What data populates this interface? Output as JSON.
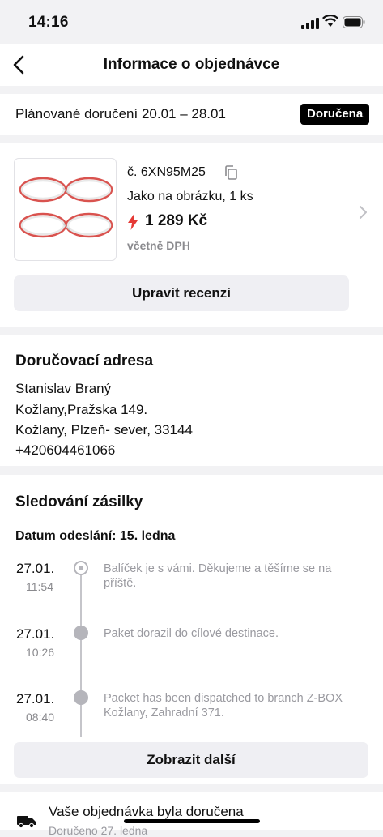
{
  "status_bar": {
    "time": "14:16"
  },
  "header": {
    "title": "Informace o objednávce"
  },
  "delivery": {
    "planned": "Plánované doručení 20.01 – 28.01",
    "status_badge": "Doručena"
  },
  "product": {
    "order_number": "č. 6XN95M25",
    "variant": "Jako na obrázku, 1 ks",
    "price": "1 289 Kč",
    "vat_note": "včetně DPH",
    "review_button": "Upravit recenzi",
    "accent_color": "#e53935"
  },
  "address": {
    "title": "Doručovací adresa",
    "lines": [
      "Stanislav Braný",
      "Kožlany,Pražska 149.",
      "Kožlany, Plzeň- sever, 33144",
      "+420604461066"
    ]
  },
  "tracking": {
    "title": "Sledování zásilky",
    "ship_date": "Datum odeslání: 15. ledna",
    "events": [
      {
        "date": "27.01.",
        "time": "11:54",
        "text": "Balíček je s vámi. Děkujeme a těšíme se na příště."
      },
      {
        "date": "27.01.",
        "time": "10:26",
        "text": "Paket dorazil do cílové destinace."
      },
      {
        "date": "27.01.",
        "time": "08:40",
        "text": "Packet has been dispatched to branch Z-BOX Kožlany, Zahradní 371."
      }
    ],
    "more_button": "Zobrazit další"
  },
  "notice": {
    "text": "Vaše objednávka byla doručena",
    "sub": "Doručeno 27. ledna"
  },
  "icons": [
    "back-chevron-icon",
    "copy-icon",
    "lightning-icon",
    "chevron-right-icon",
    "truck-icon"
  ]
}
